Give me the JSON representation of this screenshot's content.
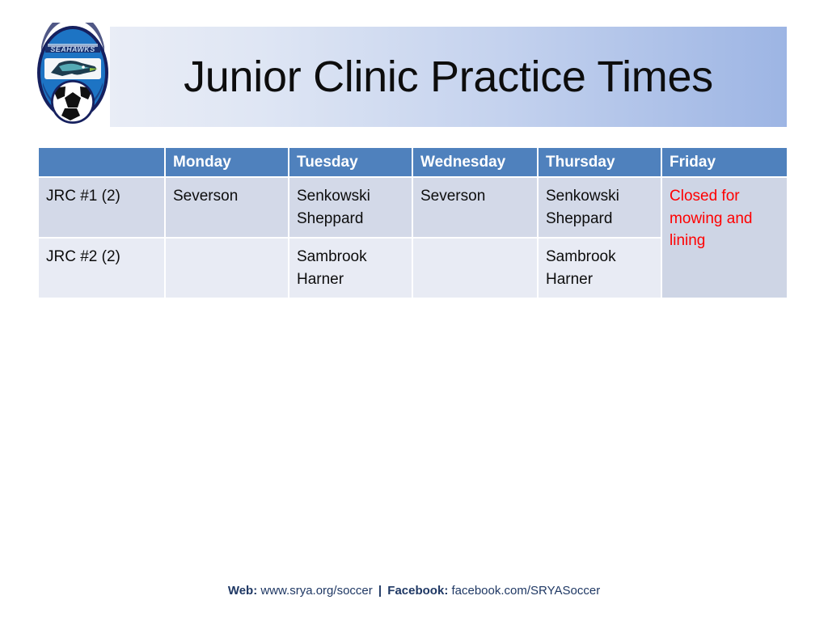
{
  "slide": {
    "title": "Junior Clinic Practice Times",
    "title_band": {
      "gradient_start": "#e9edf6",
      "gradient_end": "#9db5e4"
    }
  },
  "logo": {
    "name": "seahawks-soccer-club-badge",
    "wordmark": "SEAHAWKS",
    "shield_color": "#1d74c4",
    "border_color": "#16205e",
    "ball_colors": [
      "#ffffff",
      "#111111"
    ]
  },
  "schedule": {
    "header_color": "#4f81bd",
    "header_text_color": "#ffffff",
    "row_a_color": "#d3d9e8",
    "row_b_color": "#e8ebf4",
    "closed_cell_color": "#ced5e5",
    "closed_text_color": "#ff0000",
    "columns": [
      "",
      "Monday",
      "Tuesday",
      "Wednesday",
      "Thursday",
      "Friday"
    ],
    "rows": [
      {
        "label": "JRC #1 (2)",
        "monday": [
          "Severson"
        ],
        "tuesday": [
          "Senkowski",
          "Sheppard"
        ],
        "wednesday": [
          "Severson"
        ],
        "thursday": [
          "Senkowski",
          "Sheppard"
        ]
      },
      {
        "label": "JRC #2 (2)",
        "monday": [],
        "tuesday": [
          "Sambrook",
          "Harner"
        ],
        "wednesday": [],
        "thursday": [
          "Sambrook",
          "Harner"
        ]
      }
    ],
    "friday_note": [
      "Closed for",
      "mowing and",
      "lining"
    ]
  },
  "footer": {
    "web_label": "Web:",
    "web_value": "www.srya.org/soccer",
    "separator": "|",
    "facebook_label": "Facebook:",
    "facebook_value": "facebook.com/SRYASoccer"
  }
}
